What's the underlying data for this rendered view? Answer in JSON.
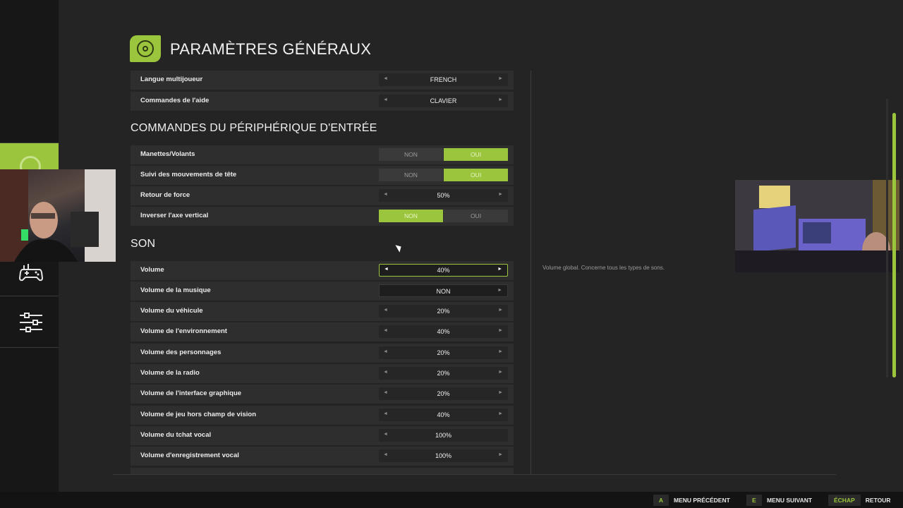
{
  "page_title": "PARAMÈTRES GÉNÉRAUX",
  "rows_top": [
    {
      "label": "Langue multijoueur",
      "value": "FRENCH"
    },
    {
      "label": "Commandes de l'aide",
      "value": "CLAVIER"
    }
  ],
  "section_input": "COMMANDES DU PÉRIPHÉRIQUE D'ENTRÉE",
  "input_rows": [
    {
      "label": "Manettes/Volants",
      "no": "NON",
      "yes": "OUI",
      "selected": "OUI"
    },
    {
      "label": "Suivi des mouvements de tête",
      "no": "NON",
      "yes": "OUI",
      "selected": "OUI"
    },
    {
      "label": "Retour de force",
      "value": "50%"
    },
    {
      "label": "Inverser l'axe vertical",
      "no": "NON",
      "yes": "OUI",
      "selected": "NON"
    }
  ],
  "section_sound": "SON",
  "sound_rows": [
    {
      "label": "Volume",
      "value": "40%",
      "focused": true
    },
    {
      "label": "Volume de la musique",
      "value": "NON"
    },
    {
      "label": "Volume du véhicule",
      "value": "20%"
    },
    {
      "label": "Volume de l'environnement",
      "value": "40%"
    },
    {
      "label": "Volume des personnages",
      "value": "20%"
    },
    {
      "label": "Volume de la radio",
      "value": "20%"
    },
    {
      "label": "Volume de l'interface graphique",
      "value": "20%"
    },
    {
      "label": "Volume de jeu hors champ de vision",
      "value": "40%"
    },
    {
      "label": "Volume du tchat vocal",
      "value": "100%"
    },
    {
      "label": "Volume d'enregistrement vocal",
      "value": "100%"
    }
  ],
  "description": "Volume global. Concerne tous les types de sons.",
  "arrows": {
    "left": "◄",
    "right": "►"
  },
  "bottom_hints": [
    {
      "key": "A",
      "label": "MENU PRÉCÉDENT"
    },
    {
      "key": "E",
      "label": "MENU SUIVANT"
    },
    {
      "key": "ÉCHAP",
      "label": "RETOUR"
    }
  ],
  "colors": {
    "accent": "#9bc53d",
    "background": "#242424",
    "row": "#2e2e2e"
  },
  "icons": [
    "gear-icon",
    "controller-icon",
    "sliders-icon"
  ]
}
